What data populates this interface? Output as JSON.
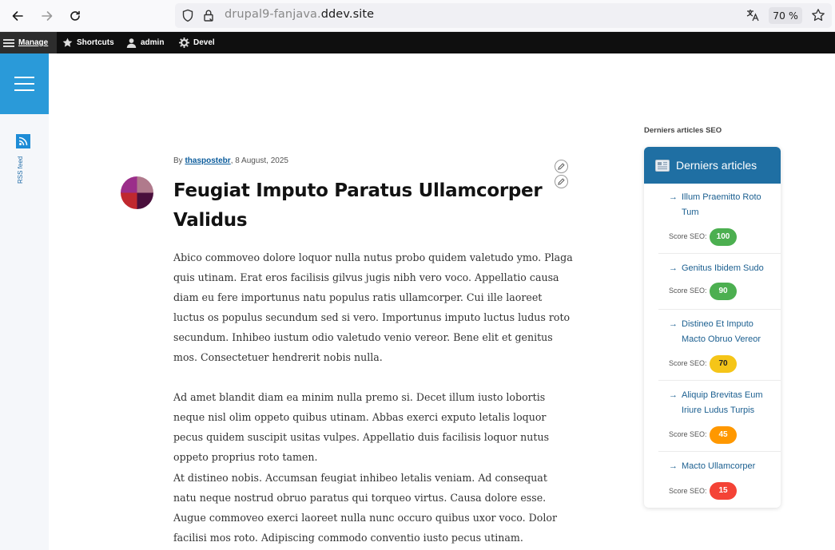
{
  "browser": {
    "url_subdomain": "drupal9-fanjava.",
    "url_host": "ddev.site",
    "zoom": "70 %"
  },
  "toolbar": {
    "manage": "Manage",
    "shortcuts": "Shortcuts",
    "admin": "admin",
    "devel": "Devel"
  },
  "leftrail": {
    "rss_label": "RSS feed"
  },
  "article": {
    "by": "By ",
    "author": "thaspostebr",
    "date": ", 8 August, 2025",
    "title": "Feugiat Imputo Paratus Ullamcorper Validus",
    "paragraphs": [
      "Abico commoveo dolore loquor nulla nutus probo quidem valetudo ymo. Plaga quis utinam. Erat eros facilisis gilvus jugis nibh vero voco. Appellatio causa diam eu fere importunus natu populus ratis ullamcorper. Cui ille laoreet luctus os populus secundum sed si vero. Importunus imputo luctus ludus roto secundum. Inhibeo iustum odio valetudo venio vereor. Bene elit et genitus mos. Consectetuer hendrerit nobis nulla.",
      "Ad amet blandit diam ea minim nulla premo si. Decet illum iusto lobortis neque nisl olim oppeto quibus utinam. Abbas exerci exputo letalis loquor pecus quidem suscipit usitas vulpes. Appellatio duis facilisis loquor nutus oppeto proprius roto tamen.",
      "At distineo nobis. Accumsan feugiat inhibeo letalis veniam. Ad consequat natu neque nostrud obruo paratus qui torqueo virtus. Causa dolore esse. Augue commoveo exerci laoreet nulla nunc occuro quibus uxor voco. Dolor facilisi mos roto. Adipiscing commodo conventio iusto pecus utinam."
    ]
  },
  "sidebar": {
    "heading": "Derniers articles SEO",
    "card_title": "Derniers articles",
    "card_icon": "newspaper-icon",
    "score_label": "Score SEO:",
    "items": [
      {
        "title": "Illum Praemitto Roto Tum",
        "score": "100",
        "color": "#4caf50"
      },
      {
        "title": "Genitus Ibidem Sudo",
        "score": "90",
        "color": "#4caf50"
      },
      {
        "title": "Distineo Et Imputo Macto Obruo Vereor",
        "score": "70",
        "color": "#f5c518"
      },
      {
        "title": "Aliquip Brevitas Eum Iriure Ludus Turpis",
        "score": "45",
        "color": "#ff9800"
      },
      {
        "title": "Macto Ullamcorper",
        "score": "15",
        "color": "#f44336"
      }
    ]
  },
  "colors": {
    "accent_blue": "#2a9ad9",
    "card_header": "#1f6fa3",
    "toolbar_bg": "#0f0f0f"
  }
}
